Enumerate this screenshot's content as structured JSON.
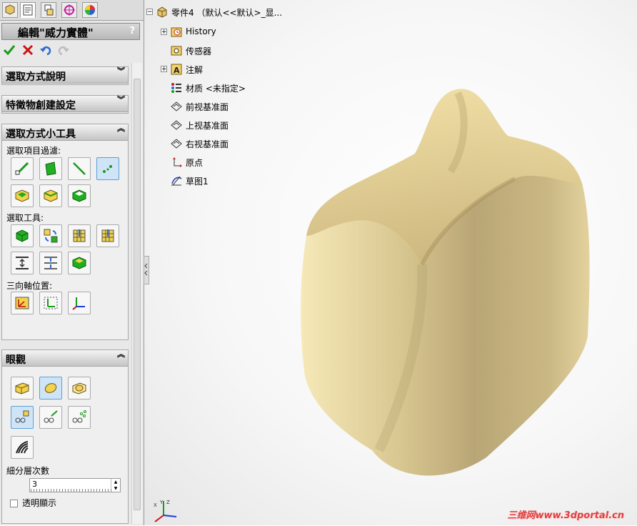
{
  "panel": {
    "title": "編輯\"威力實體\"",
    "help": "?",
    "groups": {
      "selection_help": "選取方式說明",
      "feature_settings": "特徵物創建設定",
      "selection_tools": "選取方式小工具",
      "display": "眼觀"
    },
    "labels": {
      "filter": "選取項目過濾:",
      "tools": "選取工具:",
      "triad": "三向軸位置:",
      "subdiv": "細分層次數",
      "transparent": "透明顯示"
    },
    "subdiv_value": "3"
  },
  "tree": {
    "root": "零件4 （默认<<默认>_显...",
    "items": [
      {
        "label": "History",
        "icon": "history-icon",
        "expandable": true
      },
      {
        "label": "传感器",
        "icon": "sensor-icon",
        "expandable": false
      },
      {
        "label": "注解",
        "icon": "annotation-icon",
        "expandable": true
      },
      {
        "label": "材质 <未指定>",
        "icon": "material-icon",
        "expandable": false
      },
      {
        "label": "前视基准面",
        "icon": "plane-icon",
        "expandable": false
      },
      {
        "label": "上视基准面",
        "icon": "plane-icon",
        "expandable": false
      },
      {
        "label": "右视基准面",
        "icon": "plane-icon",
        "expandable": false
      },
      {
        "label": "原点",
        "icon": "origin-icon",
        "expandable": false
      },
      {
        "label": "草图1",
        "icon": "sketch-icon",
        "expandable": false
      }
    ]
  },
  "watermark": "三维网www.3dportal.cn",
  "colors": {
    "model": "#c9b582",
    "accent_green": "#1a9a1a",
    "accent_red": "#cc1111"
  }
}
